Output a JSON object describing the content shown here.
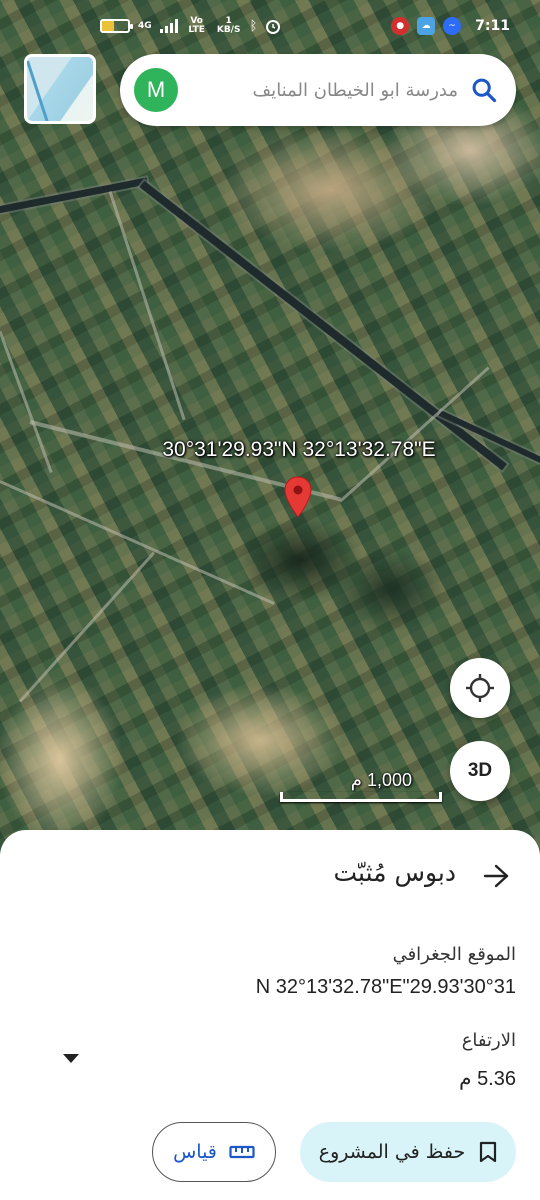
{
  "status_bar": {
    "network_type": "4G",
    "volte": "Vo LTE",
    "speed": "1 KB/S",
    "time": "7:11"
  },
  "search": {
    "query": "مدرسة ابو الخيطان المنايف",
    "avatar_initial": "M"
  },
  "map": {
    "coordinates": "30°31'29.93\"N 32°13'32.78\"E",
    "scale_label": "1,000 م",
    "button_3d": "3D"
  },
  "sheet": {
    "title": "دبوس مُثبّت",
    "location_label": "الموقع الجغرافي",
    "location_value": "N 32°13'32.78\"E\"29.93'30°31",
    "elevation_label": "الارتفاع",
    "elevation_value": "5.36 م",
    "save_label": "حفظ في المشروع",
    "measure_label": "قياس"
  },
  "colors": {
    "accent_blue": "#1a57c9",
    "save_bg": "#d8f4f8",
    "pin_red": "#e53935",
    "avatar_green": "#2fb35b"
  }
}
